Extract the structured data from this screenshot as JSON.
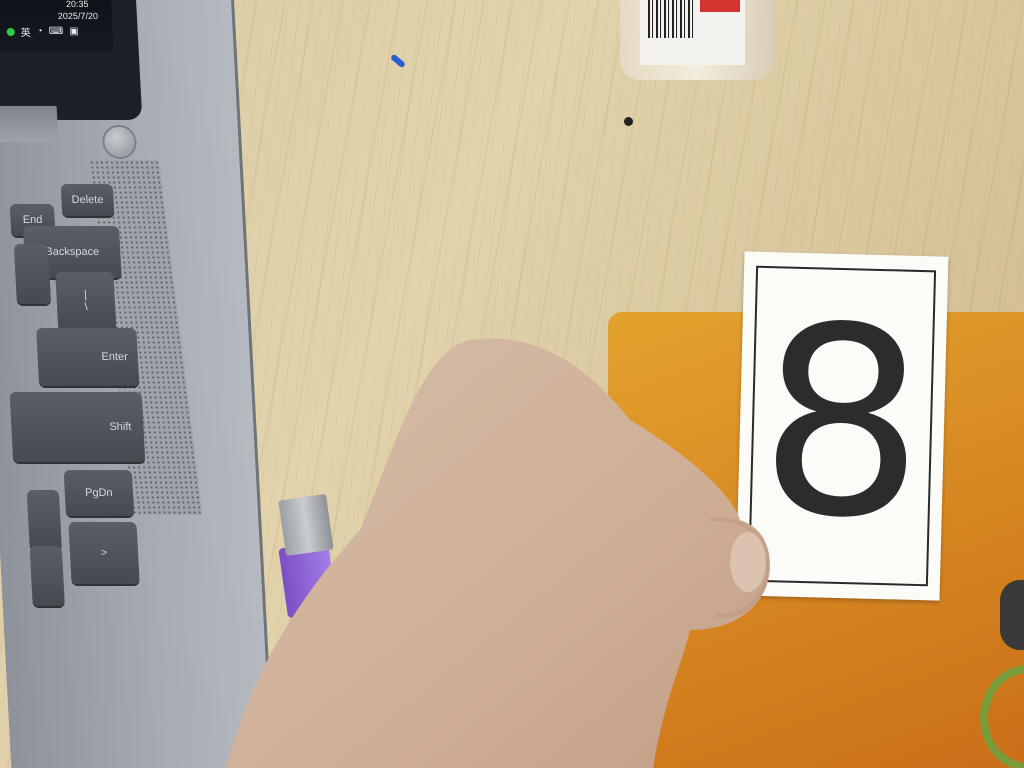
{
  "scene": {
    "taskbar": {
      "time": "20:35",
      "date": "2025/7/20",
      "ime": "英"
    },
    "keys": {
      "end": "End",
      "delete": "Delete",
      "backspace": "Backspace",
      "enter": "Enter",
      "shift": "Shift",
      "pgdn": "PgDn",
      "backslash": "\\",
      "pipe": "|",
      "gt": ">"
    },
    "card": {
      "digit": "8"
    },
    "colors": {
      "desk": "#dccca4",
      "mat": "#d88a22",
      "usb": "#8f63d6",
      "skin": "#d8b8a0"
    }
  }
}
